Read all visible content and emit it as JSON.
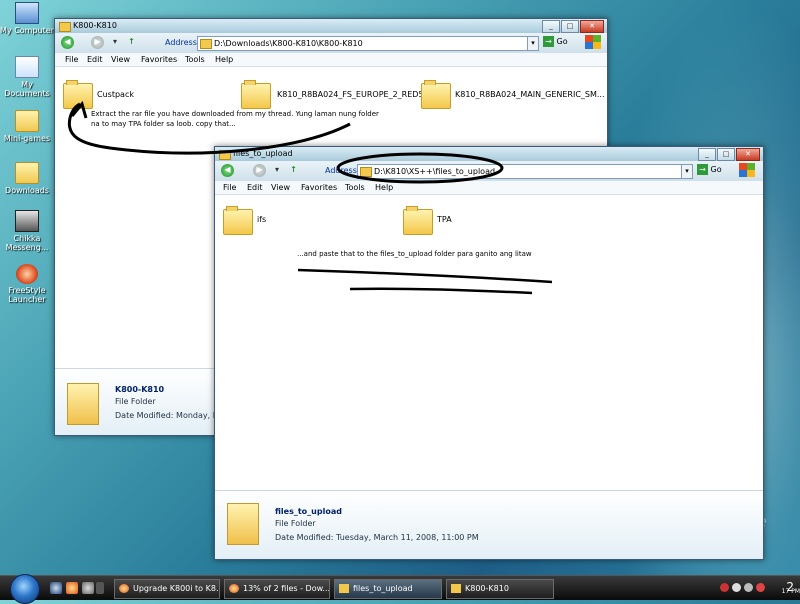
{
  "desktop": {
    "icons": [
      {
        "label": "My Computer",
        "icon": "computer-icon"
      },
      {
        "label": "My Documents",
        "icon": "documents-icon"
      },
      {
        "label": "Mini-games",
        "icon": "folder-icon"
      },
      {
        "label": "Downloads",
        "icon": "folder-icon"
      },
      {
        "label": "Chikka Messeng...",
        "icon": "chikka-icon"
      },
      {
        "label": "FreeStyle Launcher",
        "icon": "freestyle-icon"
      }
    ],
    "watermark": "nce"
  },
  "window1": {
    "title": "K800-K810",
    "address_label": "Address",
    "address": "D:\\Downloads\\K800-K810\\K800-K810",
    "go": "Go",
    "menu": [
      "File",
      "Edit",
      "View",
      "Favorites",
      "Tools",
      "Help"
    ],
    "items": [
      {
        "name": "Custpack"
      },
      {
        "name": "K810_R8BA024_FS_EUROPE_2_RED5..."
      },
      {
        "name": "K810_R8BA024_MAIN_GENERIC_SM..."
      }
    ],
    "note": "Extract the rar file you have downloaded from my thread. Yung laman nung folder na to may TPA folder sa loob. copy that...",
    "details": {
      "name": "K800-K810",
      "type": "File Folder",
      "date": "Date Modified: Monday, Febr"
    }
  },
  "window2": {
    "title": "files_to_upload",
    "address_label": "Address",
    "address": "D:\\K810\\XS++\\files_to_upload",
    "go": "Go",
    "menu": [
      "File",
      "Edit",
      "View",
      "Favorites",
      "Tools",
      "Help"
    ],
    "items": [
      {
        "name": "ifs"
      },
      {
        "name": "TPA"
      }
    ],
    "note": "...and paste that to the files_to_upload folder para ganito ang litaw",
    "details": {
      "name": "files_to_upload",
      "type": "File Folder",
      "date": "Date Modified: Tuesday, March 11, 2008, 11:00 PM"
    }
  },
  "taskbar": {
    "buttons": [
      {
        "label": "Upgrade K800i to K8...",
        "icon": "firefox-icon"
      },
      {
        "label": "13% of 2 files - Dow...",
        "icon": "firefox-icon"
      },
      {
        "label": "files_to_upload",
        "icon": "folder-icon"
      },
      {
        "label": "K800-K810",
        "icon": "folder-icon"
      }
    ],
    "clock": "2",
    "clock_small": "17 PM"
  },
  "colors": {
    "accent": "#1e5e86",
    "title_text": "#000000",
    "folder": "#f3c84a"
  }
}
